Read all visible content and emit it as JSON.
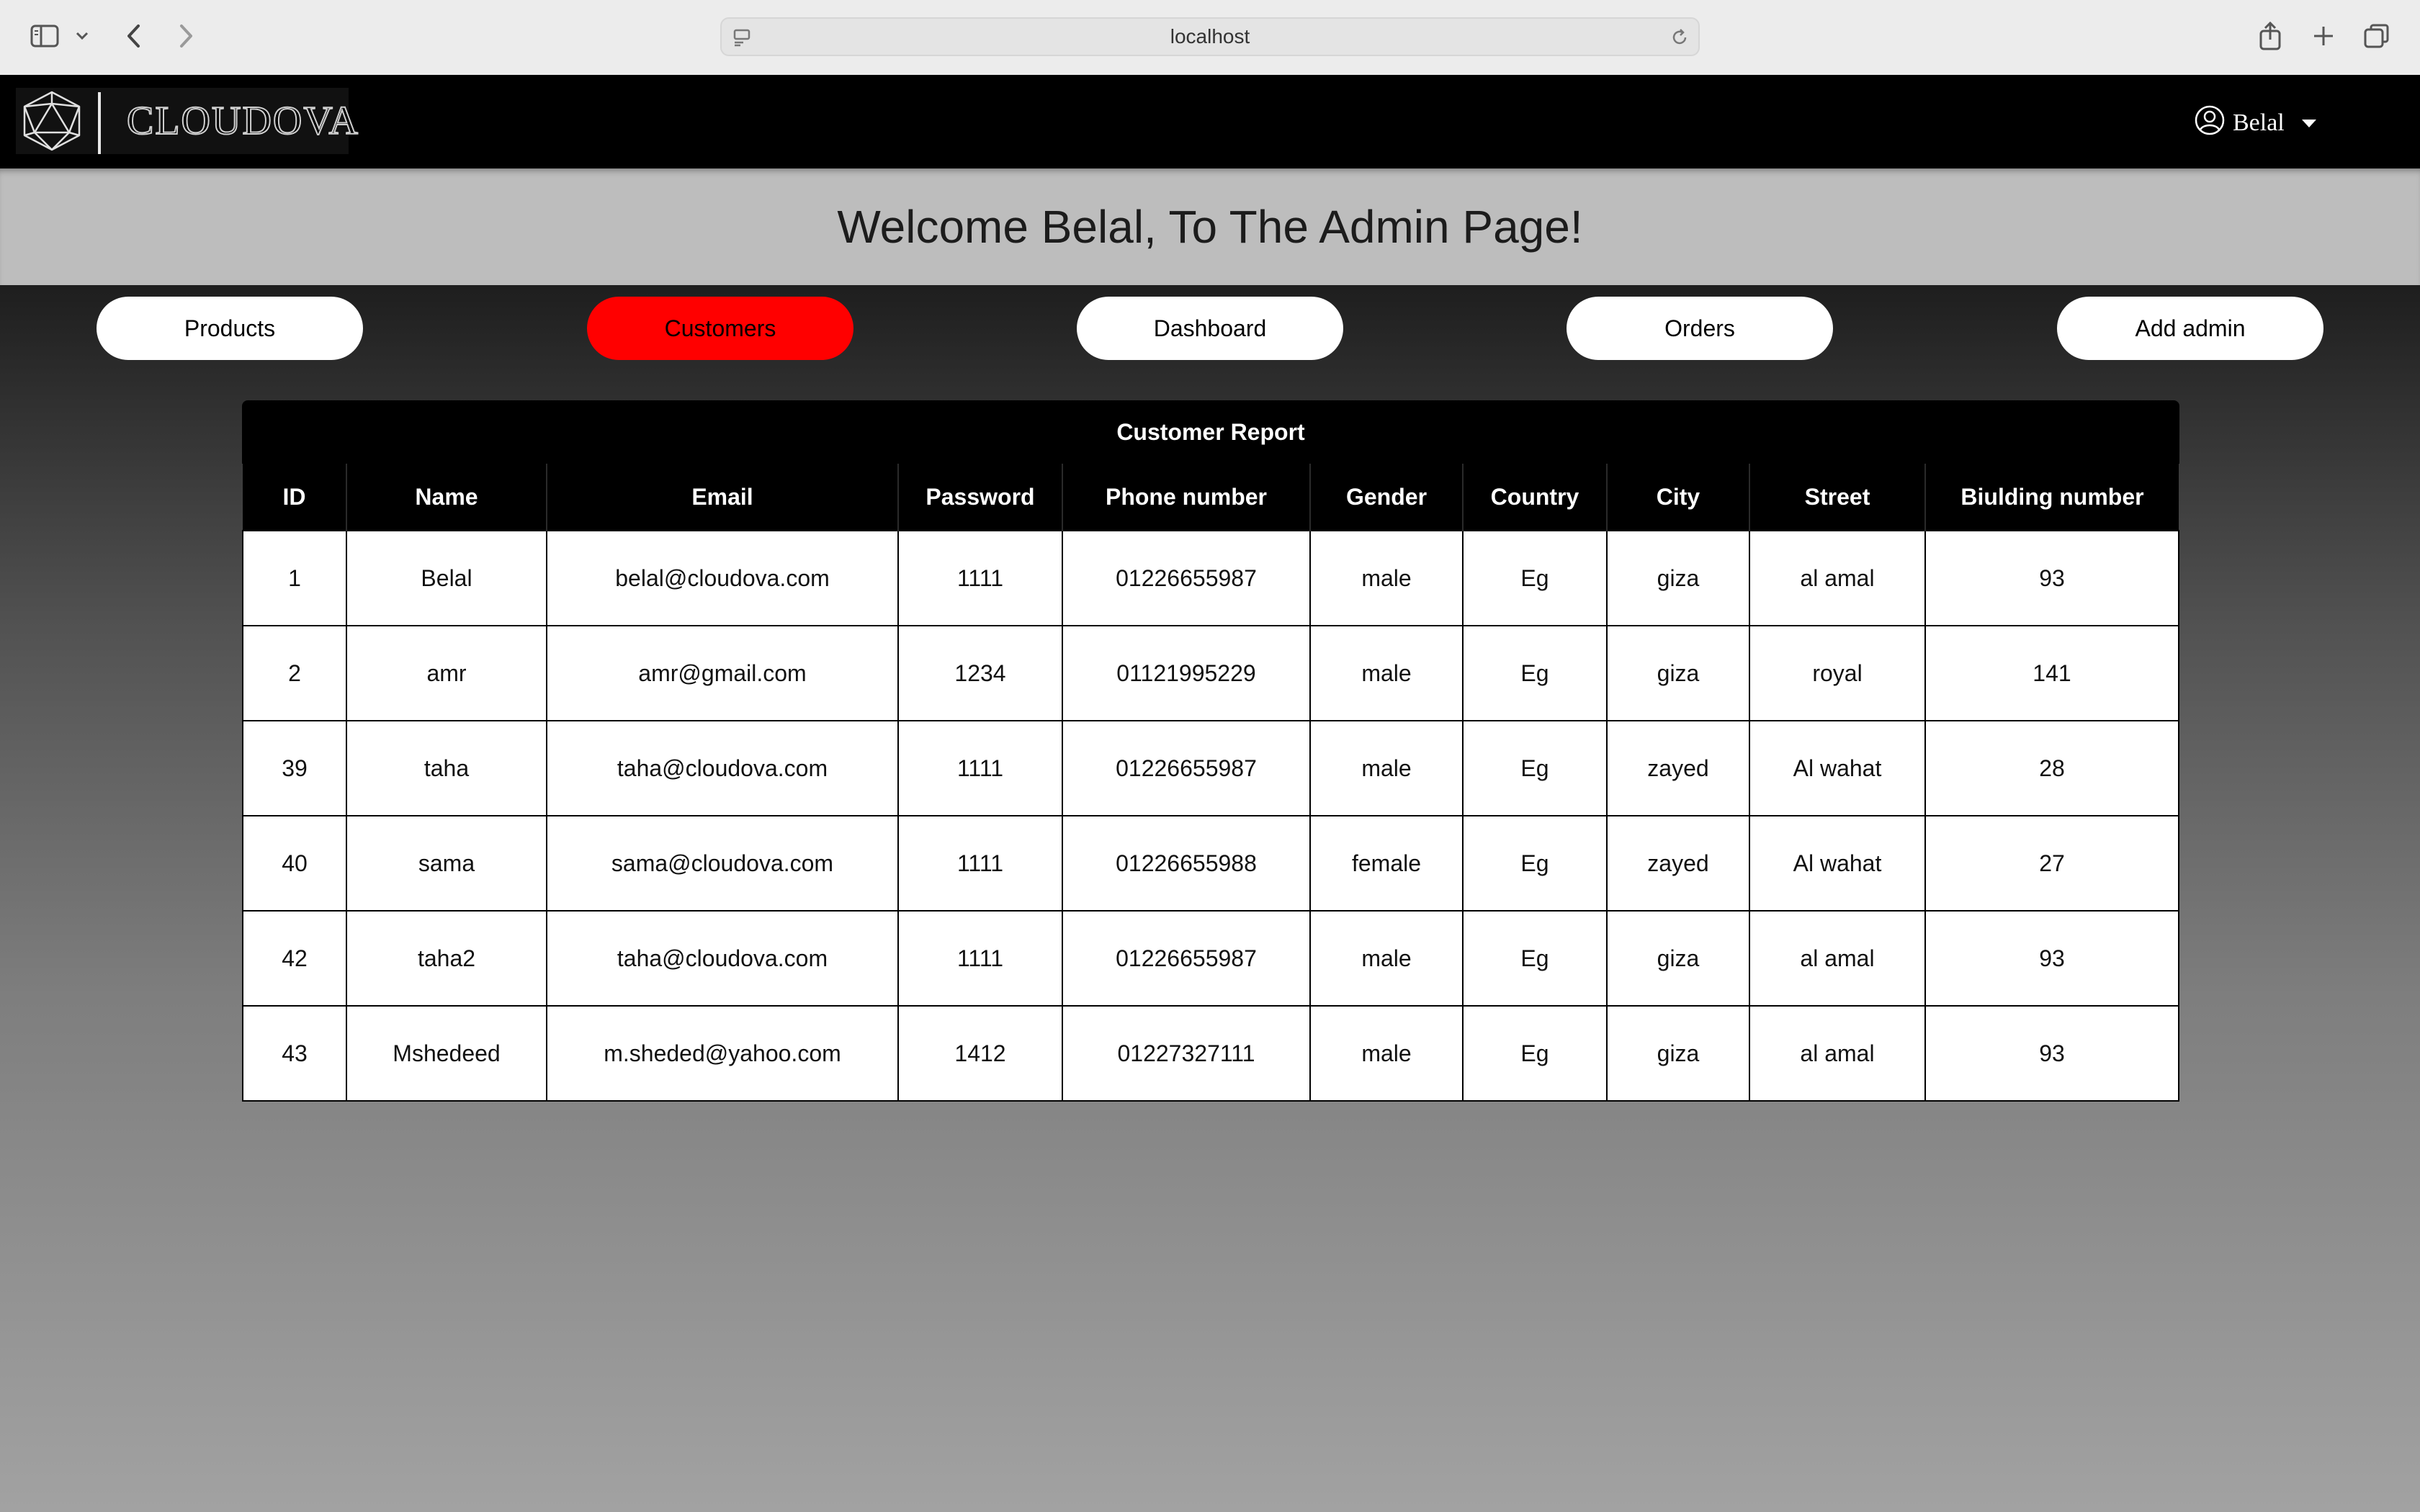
{
  "browser": {
    "url": "localhost"
  },
  "header": {
    "logo_text": "CLOUDOVA",
    "user_name": "Belal"
  },
  "welcome": {
    "title": "Welcome Belal, To The Admin Page!"
  },
  "nav": {
    "products": "Products",
    "customers": "Customers",
    "dashboard": "Dashboard",
    "orders": "Orders",
    "add_admin": "Add admin",
    "active": "Customers",
    "active_color": "#ff0000"
  },
  "table": {
    "caption": "Customer Report",
    "columns": [
      "ID",
      "Name",
      "Email",
      "Password",
      "Phone number",
      "Gender",
      "Country",
      "City",
      "Street",
      "Biulding number"
    ],
    "rows": [
      [
        "1",
        "Belal",
        "belal@cloudova.com",
        "1111",
        "01226655987",
        "male",
        "Eg",
        "giza",
        "al amal",
        "93"
      ],
      [
        "2",
        "amr",
        "amr@gmail.com",
        "1234",
        "01121995229",
        "male",
        "Eg",
        "giza",
        "royal",
        "141"
      ],
      [
        "39",
        "taha",
        "taha@cloudova.com",
        "1111",
        "01226655987",
        "male",
        "Eg",
        "zayed",
        "Al wahat",
        "28"
      ],
      [
        "40",
        "sama",
        "sama@cloudova.com",
        "1111",
        "01226655988",
        "female",
        "Eg",
        "zayed",
        "Al wahat",
        "27"
      ],
      [
        "42",
        "taha2",
        "taha@cloudova.com",
        "1111",
        "01226655987",
        "male",
        "Eg",
        "giza",
        "al amal",
        "93"
      ],
      [
        "43",
        "Mshedeed",
        "m.sheded@yahoo.com",
        "1412",
        "01227327111",
        "male",
        "Eg",
        "giza",
        "al amal",
        "93"
      ]
    ]
  },
  "icons": {
    "sidebar": "sidebar-icon",
    "chevron": "chevron-down-icon",
    "back": "back-arrow-icon",
    "forward": "forward-arrow-icon",
    "page": "page-icon",
    "reload": "reload-icon",
    "share": "share-icon",
    "new_tab": "plus-icon",
    "tabs": "tabs-overview-icon",
    "logo": "icosahedron-logo-icon",
    "user": "user-circle-icon"
  }
}
